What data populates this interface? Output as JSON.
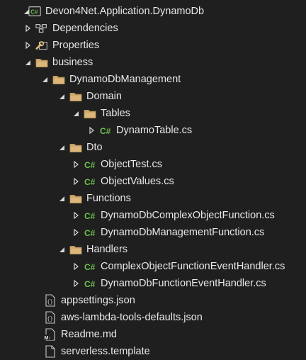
{
  "tree": [
    {
      "id": "project",
      "label": "Devon4Net.Application.DynamoDb",
      "icon": "csharp-project-icon",
      "arrow": "expanded-root",
      "depth": 0
    },
    {
      "id": "dependencies",
      "label": "Dependencies",
      "icon": "dependencies-icon",
      "arrow": "collapsed",
      "depth": 1
    },
    {
      "id": "properties",
      "label": "Properties",
      "icon": "properties-wrench-icon",
      "arrow": "collapsed",
      "depth": 1
    },
    {
      "id": "business",
      "label": "business",
      "icon": "folder-icon",
      "arrow": "expanded",
      "depth": 1
    },
    {
      "id": "dynamodbmanagement",
      "label": "DynamoDbManagement",
      "icon": "folder-icon",
      "arrow": "expanded",
      "depth": 2
    },
    {
      "id": "domain",
      "label": "Domain",
      "icon": "folder-icon",
      "arrow": "expanded",
      "depth": 3
    },
    {
      "id": "tables",
      "label": "Tables",
      "icon": "folder-icon",
      "arrow": "expanded",
      "depth": 4
    },
    {
      "id": "dynamotable",
      "label": "DynamoTable.cs",
      "icon": "csharp-file-icon",
      "arrow": "collapsed",
      "depth": 5
    },
    {
      "id": "dto",
      "label": "Dto",
      "icon": "folder-icon",
      "arrow": "expanded",
      "depth": 3
    },
    {
      "id": "objecttest",
      "label": "ObjectTest.cs",
      "icon": "csharp-file-icon",
      "arrow": "collapsed",
      "depth": 4
    },
    {
      "id": "objectvalues",
      "label": "ObjectValues.cs",
      "icon": "csharp-file-icon",
      "arrow": "collapsed",
      "depth": 4
    },
    {
      "id": "functions",
      "label": "Functions",
      "icon": "folder-icon",
      "arrow": "expanded",
      "depth": 3
    },
    {
      "id": "complexobjectfunction",
      "label": "DynamoDbComplexObjectFunction.cs",
      "icon": "csharp-file-icon",
      "arrow": "collapsed",
      "depth": 4
    },
    {
      "id": "managementfunction",
      "label": "DynamoDbManagementFunction.cs",
      "icon": "csharp-file-icon",
      "arrow": "collapsed",
      "depth": 4
    },
    {
      "id": "handlers",
      "label": "Handlers",
      "icon": "folder-icon",
      "arrow": "expanded",
      "depth": 3
    },
    {
      "id": "complexhandler",
      "label": "ComplexObjectFunctionEventHandler.cs",
      "icon": "csharp-file-icon",
      "arrow": "collapsed",
      "depth": 4
    },
    {
      "id": "functionhandler",
      "label": "DynamoDbFunctionEventHandler.cs",
      "icon": "csharp-file-icon",
      "arrow": "collapsed",
      "depth": 4
    },
    {
      "id": "appsettings",
      "label": "appsettings.json",
      "icon": "json-file-icon",
      "arrow": "none",
      "depth": 1
    },
    {
      "id": "awslambda",
      "label": "aws-lambda-tools-defaults.json",
      "icon": "json-file-icon",
      "arrow": "none",
      "depth": 1
    },
    {
      "id": "readme",
      "label": "Readme.md",
      "icon": "markdown-file-icon",
      "arrow": "none",
      "depth": 1
    },
    {
      "id": "serverless",
      "label": "serverless.template",
      "icon": "text-file-icon",
      "arrow": "none",
      "depth": 1
    }
  ],
  "colors": {
    "background": "#1f1f1f",
    "text": "#e8e8e8",
    "folder": "#dcb67a",
    "csharp": "#6cc24a",
    "project_icon": "#6cc24a",
    "file_outline": "#c8c8c8"
  }
}
